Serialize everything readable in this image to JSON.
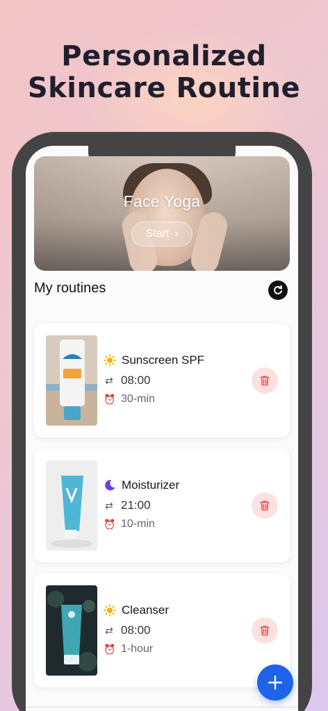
{
  "headline": {
    "line1": "Personalized",
    "line2": "Skincare Routine"
  },
  "hero": {
    "title": "Face Yoga",
    "start_label": "Start",
    "start_chevron": "›"
  },
  "routines": {
    "title": "My routines",
    "refresh_icon": "refresh-icon",
    "items": [
      {
        "name": "Sunscreen SPF",
        "period": "day",
        "time": "08:00",
        "duration": "30-min"
      },
      {
        "name": "Moisturizer",
        "period": "night",
        "time": "21:00",
        "duration": "10-min"
      },
      {
        "name": "Cleanser",
        "period": "day",
        "time": "08:00",
        "duration": "1-hour"
      }
    ]
  },
  "fab": {
    "icon": "plus-icon"
  },
  "colors": {
    "accent": "#1e63e8",
    "delete_bg": "#fde1e1",
    "delete_icon": "#e25252",
    "sun": "#f5b400",
    "moon": "#6a3df2"
  }
}
